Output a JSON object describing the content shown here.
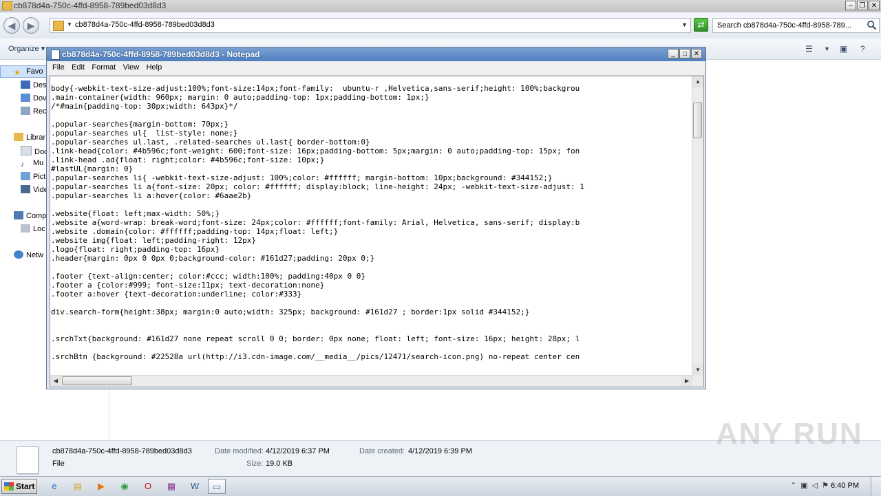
{
  "explorer": {
    "title": "cb878d4a-750c-4ffd-8958-789bed03d8d3",
    "address": "cb878d4a-750c-4ffd-8958-789bed03d8d3",
    "search_placeholder": "Search cb878d4a-750c-4ffd-8958-789...",
    "toolbar": {
      "organize": "Organize"
    },
    "nav": {
      "favorites": "Favo",
      "desktop": "Des",
      "downloads": "Dov",
      "recent": "Rec",
      "libraries": "Librar",
      "documents": "Doc",
      "music": "Mu",
      "pictures": "Pict",
      "videos": "Vide",
      "computer": "Comp",
      "local_disk": "Loc",
      "network": "Netw"
    },
    "details": {
      "filename": "cb878d4a-750c-4ffd-8958-789bed03d8d3",
      "type": "File",
      "modified_label": "Date modified:",
      "modified_value": "4/12/2019 6:37 PM",
      "created_label": "Date created:",
      "created_value": "4/12/2019 6:39 PM",
      "size_label": "Size:",
      "size_value": "19.0 KB"
    }
  },
  "notepad": {
    "title": "cb878d4a-750c-4ffd-8958-789bed03d8d3 - Notepad",
    "menu": [
      "File",
      "Edit",
      "Format",
      "View",
      "Help"
    ],
    "lines": [
      "body{-webkit-text-size-adjust:100%;font-size:14px;font-family:  ubuntu-r ,Helvetica,sans-serif;height: 100%;backgrou",
      ".main-container{width: 960px; margin: 0 auto;padding-top: 1px;padding-bottom: 1px;}",
      "/*#main{padding-top: 30px;width: 643px}*/",
      "",
      ".popular-searches{margin-bottom: 70px;}",
      ".popular-searches ul{  list-style: none;}",
      ".popular-searches ul.last, .related-searches ul.last{ border-bottom:0}",
      ".link-head{color: #4b596c;font-weight: 600;font-size: 16px;padding-bottom: 5px;margin: 0 auto;padding-top: 15px; fon",
      ".link-head .ad{float: right;color: #4b596c;font-size: 10px;}",
      "#lastUL{margin: 0}",
      ".popular-searches li{ -webkit-text-size-adjust: 100%;color: #ffffff; margin-bottom: 10px;background: #344152;}",
      ".popular-searches li a{font-size: 20px; color: #ffffff; display:block; line-height: 24px; -webkit-text-size-adjust: 1",
      ".popular-searches li a:hover{color: #6aae2b}",
      "",
      ".website{float: left;max-width: 50%;}",
      ".website a{word-wrap: break-word;font-size: 24px;color: #ffffff;font-family: Arial, Helvetica, sans-serif; display:b",
      ".website .domain{color: #ffffff;padding-top: 14px;float: left;}",
      ".website img{float: left;padding-right: 12px}",
      ".logo{float: right;padding-top: 16px}",
      ".header{margin: 0px 0 0px 0;background-color: #161d27;padding: 20px 0;}",
      "",
      ".footer {text-align:center; color:#ccc; width:100%; padding:40px 0 0}",
      ".footer a {color:#999; font-size:11px; text-decoration:none}",
      ".footer a:hover {text-decoration:underline; color:#333}",
      "",
      "div.search-form{height:38px; margin:0 auto;width: 325px; background: #161d27 ; border:1px solid #344152;}",
      "",
      "",
      ".srchTxt{background: #161d27 none repeat scroll 0 0; border: 0px none; float: left; font-size: 16px; height: 28px; l",
      "",
      ".srchBtn {background: #22528a url(http://i3.cdn-image.com/__media__/pics/12471/search-icon.png) no-repeat center cen"
    ]
  },
  "taskbar": {
    "start": "Start",
    "clock": "6:40 PM"
  },
  "watermark": "ANY RUN",
  "colors": {
    "notepad_title": "#4f7fbf",
    "taskbar": "#cdd5df"
  }
}
